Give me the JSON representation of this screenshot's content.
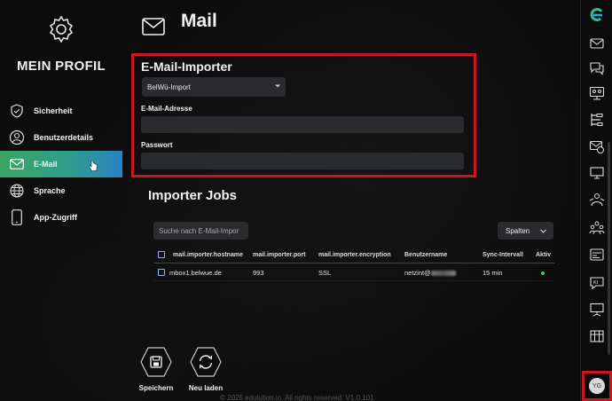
{
  "profile": {
    "title": "MEIN PROFIL"
  },
  "nav": [
    {
      "label": "Sicherheit",
      "icon": "shield-icon"
    },
    {
      "label": "Benutzerdetails",
      "icon": "users-gear-icon"
    },
    {
      "label": "E-Mail",
      "icon": "mail-icon",
      "active": true
    },
    {
      "label": "Sprache",
      "icon": "globe-icon"
    },
    {
      "label": "App-Zugriff",
      "icon": "phone-icon"
    }
  ],
  "header": {
    "title": "Mail"
  },
  "importer": {
    "title": "E-Mail-Importer",
    "selected": "BelWü-Import",
    "email_label": "E-Mail-Adresse",
    "email_value": "",
    "password_label": "Passwort",
    "password_value": ""
  },
  "jobs": {
    "title": "Importer Jobs",
    "search_placeholder": "Suche nach E-Mail-Impor",
    "columns_button": "Spalten",
    "headers": [
      "mail.importer.hostname",
      "mail.importer.port",
      "mail.importer.encryption",
      "Benutzername",
      "Sync-Intervall",
      "Aktiv"
    ],
    "rows": [
      {
        "hostname": "mbox1.belwue.de",
        "port": "993",
        "encryption": "SSL",
        "username": "netzint@",
        "interval": "15 min",
        "active": true
      }
    ]
  },
  "actions": {
    "save": "Speichern",
    "reload": "Neu laden"
  },
  "footer": "© 2025 edulution.io. All rights reserved. V1.0.101",
  "user": {
    "initials": "YG"
  },
  "colors": {
    "accent_red": "#c8171f",
    "active_green": "#3aa563",
    "active_blue": "#2a83c4",
    "field_bg": "#2a2b2f"
  }
}
